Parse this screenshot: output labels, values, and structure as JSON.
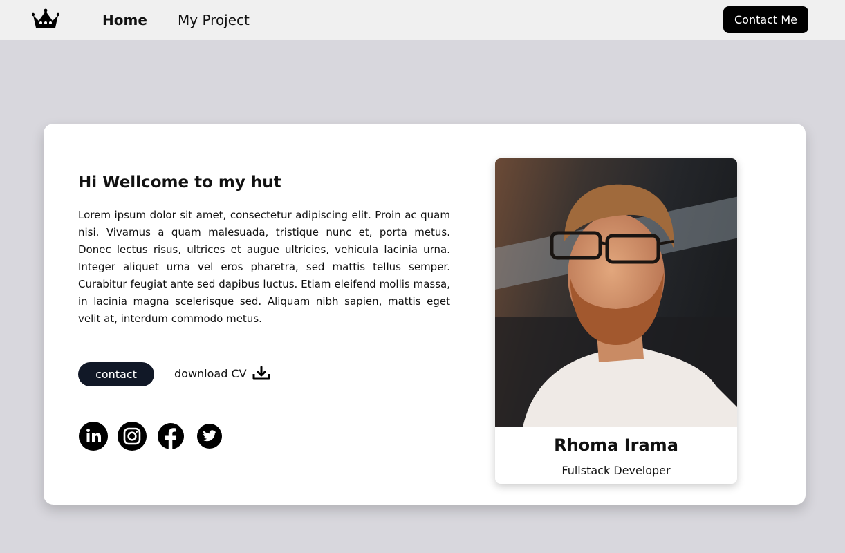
{
  "nav": {
    "logo_icon": "crown-icon",
    "links": [
      {
        "label": "Home",
        "active": true
      },
      {
        "label": "My Project",
        "active": false
      }
    ],
    "contact_label": "Contact Me"
  },
  "hero": {
    "title": "Hi Wellcome to my hut",
    "bio": "Lorem ipsum dolor sit amet, consectetur adipiscing elit. Proin ac quam nisi. Vivamus a quam malesuada, tristique nunc et, porta metus. Donec lectus risus, ultrices et augue ultricies, vehicula lacinia urna. Integer aliquet urna vel eros pharetra, sed mattis tellus semper. Curabitur feugiat ante sed dapibus luctus. Etiam eleifend mollis massa, in lacinia magna scelerisque sed. Aliquam nibh sapien, mattis eget velit at, interdum commodo metus.",
    "contact_label": "contact",
    "download_label": "download CV",
    "download_icon": "download-icon",
    "socials": [
      {
        "icon": "linkedin-icon"
      },
      {
        "icon": "instagram-icon"
      },
      {
        "icon": "facebook-icon"
      },
      {
        "icon": "twitter-icon"
      }
    ]
  },
  "profile": {
    "name": "Rhoma Irama",
    "role": "Fullstack Developer",
    "photo_icon": "profile-photo"
  },
  "colors": {
    "page_bg": "#d8d7dd",
    "nav_bg": "#f0f0f0",
    "card_bg": "#ffffff",
    "contact_me_bg": "#000000",
    "contact_btn_bg": "#111827"
  }
}
